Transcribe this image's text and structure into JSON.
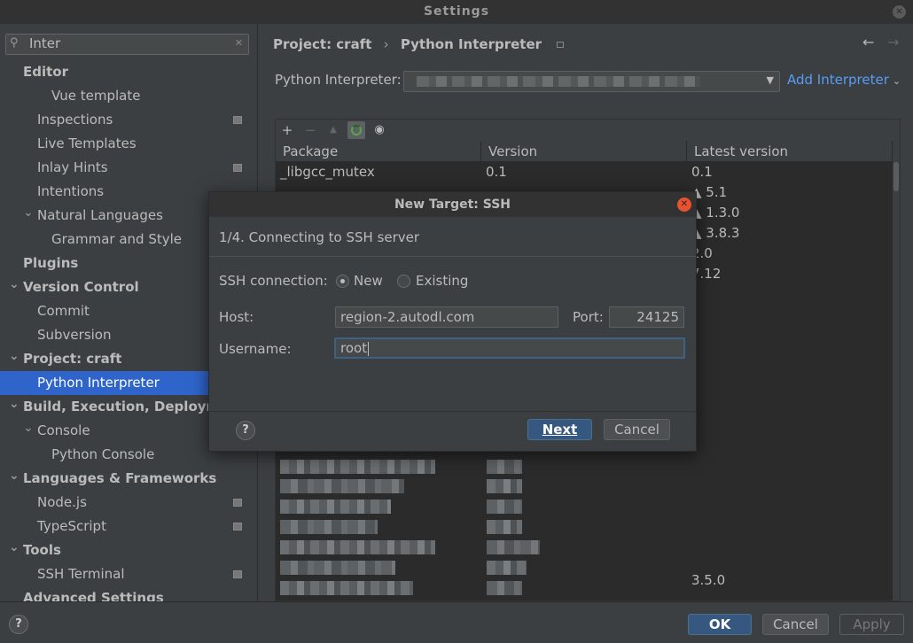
{
  "window": {
    "title": "Settings"
  },
  "search": {
    "value": "Inter"
  },
  "sidebar": {
    "items": [
      {
        "label": "Editor",
        "level": 0,
        "bold": true,
        "arrow": ""
      },
      {
        "label": "Vue template",
        "level": 2,
        "bold": false,
        "arrow": ""
      },
      {
        "label": "Inspections",
        "level": 1,
        "bold": false,
        "arrow": "",
        "icon": true
      },
      {
        "label": "Live Templates",
        "level": 1,
        "bold": false,
        "arrow": ""
      },
      {
        "label": "Inlay Hints",
        "level": 1,
        "bold": false,
        "arrow": "",
        "icon": true
      },
      {
        "label": "Intentions",
        "level": 1,
        "bold": false,
        "arrow": ""
      },
      {
        "label": "Natural Languages",
        "level": 1,
        "bold": false,
        "arrow": "v"
      },
      {
        "label": "Grammar and Style",
        "level": 2,
        "bold": false,
        "arrow": ""
      },
      {
        "label": "Plugins",
        "level": 0,
        "bold": true,
        "arrow": ""
      },
      {
        "label": "Version Control",
        "level": 0,
        "bold": true,
        "arrow": "v"
      },
      {
        "label": "Commit",
        "level": 1,
        "bold": false,
        "arrow": ""
      },
      {
        "label": "Subversion",
        "level": 1,
        "bold": false,
        "arrow": ""
      },
      {
        "label": "Project: craft",
        "level": 0,
        "bold": true,
        "arrow": "v"
      },
      {
        "label": "Python Interpreter",
        "level": 1,
        "bold": false,
        "arrow": "",
        "selected": true
      },
      {
        "label": "Build, Execution, Deployment",
        "level": 0,
        "bold": true,
        "arrow": "v"
      },
      {
        "label": "Console",
        "level": 1,
        "bold": false,
        "arrow": "v"
      },
      {
        "label": "Python Console",
        "level": 2,
        "bold": false,
        "arrow": ""
      },
      {
        "label": "Languages & Frameworks",
        "level": 0,
        "bold": true,
        "arrow": "v"
      },
      {
        "label": "Node.js",
        "level": 1,
        "bold": false,
        "arrow": "",
        "icon": true
      },
      {
        "label": "TypeScript",
        "level": 1,
        "bold": false,
        "arrow": "",
        "icon": true
      },
      {
        "label": "Tools",
        "level": 0,
        "bold": true,
        "arrow": "v"
      },
      {
        "label": "SSH Terminal",
        "level": 1,
        "bold": false,
        "arrow": "",
        "icon": true
      },
      {
        "label": "Advanced Settings",
        "level": 0,
        "bold": true,
        "arrow": ""
      }
    ]
  },
  "breadcrumb": {
    "parent": "Project: craft",
    "sep": "›",
    "current": "Python Interpreter"
  },
  "nav": {
    "back": "←",
    "forward": "→"
  },
  "interpreter": {
    "label": "Python Interpreter:",
    "add_label": "Add Interpreter",
    "caret": "⌄"
  },
  "packages": {
    "columns": [
      "Package",
      "Version",
      "Latest version"
    ],
    "rows": [
      {
        "package": "_libgcc_mutex",
        "version": "0.1",
        "latest": "0.1"
      },
      {
        "package": "",
        "version": "",
        "latest": "▲ 5.1"
      },
      {
        "package": "",
        "version": "",
        "latest": "▲ 1.3.0"
      },
      {
        "package": "",
        "version": "",
        "latest": "▲ 3.8.3"
      },
      {
        "package": "",
        "version": "",
        "latest": "2.0"
      },
      {
        "package": "",
        "version": "",
        "latest": "7.12"
      }
    ],
    "bottom_latest": "3.5.0"
  },
  "toolbar": {
    "add": "+",
    "remove": "−",
    "up": "▲",
    "show": "◉"
  },
  "modal": {
    "title": "New Target: SSH",
    "step": "1/4. Connecting to SSH server",
    "ssh_connection_label": "SSH connection:",
    "option_new": "New",
    "option_existing": "Existing",
    "host_label": "Host:",
    "host_value": "region-2.autodl.com",
    "port_label": "Port:",
    "port_value": "24125",
    "username_label": "Username:",
    "username_value": "root",
    "help": "?",
    "next_label": "Next",
    "cancel_label": "Cancel"
  },
  "footer": {
    "help": "?",
    "ok_label": "OK",
    "cancel_label": "Cancel",
    "apply_label": "Apply"
  }
}
